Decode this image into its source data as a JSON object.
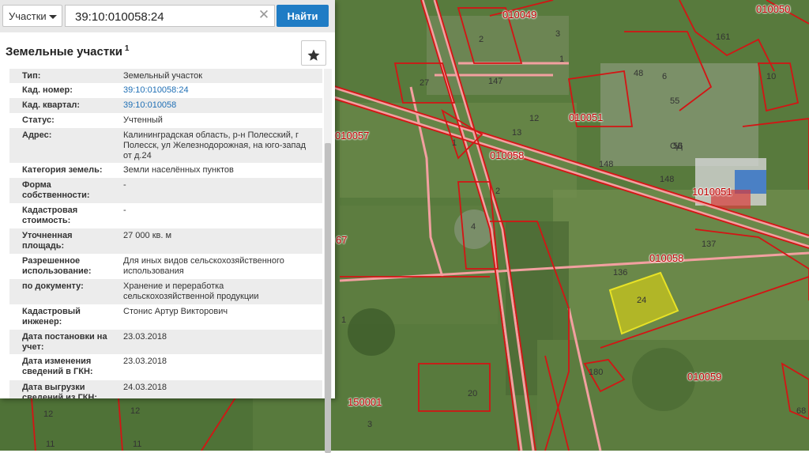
{
  "search": {
    "type_label": "Участки",
    "query": "39:10:010058:24",
    "find_label": "Найти"
  },
  "panel": {
    "title": "Земельные участки",
    "title_sup": "1"
  },
  "properties": [
    {
      "key": "Тип:",
      "value": "Земельный участок",
      "link": false
    },
    {
      "key": "Кад. номер:",
      "value": "39:10:010058:24",
      "link": true
    },
    {
      "key": "Кад. квартал:",
      "value": "39:10:010058",
      "link": true
    },
    {
      "key": "Статус:",
      "value": "Учтенный",
      "link": false
    },
    {
      "key": "Адрес:",
      "value": "Калининградская область, р-н Полесский, г Полесск, ул Железнодорожная, на юго-запад от д.24",
      "link": false
    },
    {
      "key": "Категория земель:",
      "value": "Земли населённых пунктов",
      "link": false
    },
    {
      "key": "Форма собственности:",
      "value": "-",
      "link": false
    },
    {
      "key": "Кадастровая стоимость:",
      "value": "-",
      "link": false
    },
    {
      "key": "Уточненная площадь:",
      "value": "27 000 кв. м",
      "link": false
    },
    {
      "key": "Разрешенное использование:",
      "value": "Для иных видов сельскохозяйственного использования",
      "link": false
    },
    {
      "key": "по документу:",
      "value": "Хранение и переработка сельскохозяйственной продукции",
      "link": false
    },
    {
      "key": "Кадастровый инженер:",
      "value": "Стонис Артур Викторович",
      "link": false
    },
    {
      "key": "Дата постановки на учет:",
      "value": "23.03.2018",
      "link": false
    },
    {
      "key": "Дата изменения сведений в ГКН:",
      "value": "23.03.2018",
      "link": false
    },
    {
      "key": "Дата выгрузки сведений из ГКН:",
      "value": "24.03.2018",
      "link": false
    }
  ],
  "map_labels": [
    "010049",
    "010050",
    "2",
    "3",
    "1",
    "27",
    "147",
    "48",
    "6",
    "161",
    "55",
    "12",
    "010051",
    "10",
    "ОД",
    "010057",
    "13",
    "010058",
    "148",
    "148",
    "1010051",
    "2",
    "137",
    "136",
    "010058",
    "24",
    "180",
    "010059",
    "67",
    "1",
    "20",
    "150001",
    "3",
    "12",
    "12",
    "11",
    "11",
    "68",
    "1",
    "4",
    "56"
  ],
  "colors": {
    "boundary": "#d41414",
    "road_boundary": "#f2a0a0",
    "selected_fill": "#c9c61c",
    "find_button": "#1f7cc5",
    "link": "#1f6fb5"
  }
}
